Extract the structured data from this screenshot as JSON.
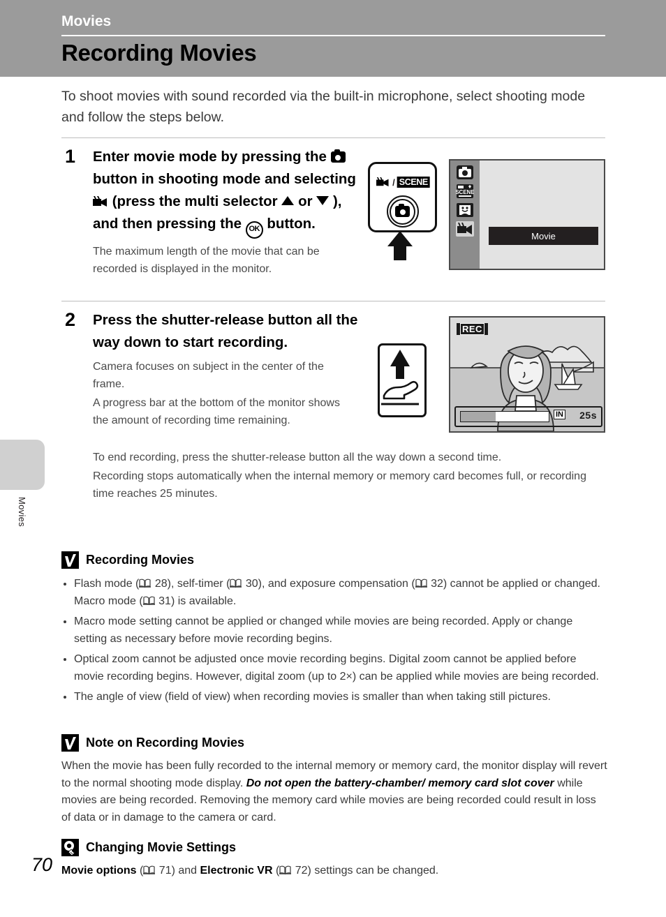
{
  "header": {
    "chapter": "Movies",
    "title": "Recording Movies"
  },
  "thumb_tab": {
    "label": "Movies"
  },
  "intro": "To shoot movies with sound recorded via the built-in microphone, select shooting mode and follow the steps below.",
  "steps": [
    {
      "number": "1",
      "head_part1": "Enter movie mode by pressing the",
      "head_part2": "button in shooting mode and selecting",
      "head_part3": "(press the multi selector",
      "head_part4": "or",
      "head_part5": "), and then pressing the",
      "head_part6": "button.",
      "sub": [
        "The maximum length of the movie that can be recorded is displayed in the monitor."
      ]
    },
    {
      "number": "2",
      "head": "Press the shutter-release button all the way down to start recording.",
      "sub": [
        "Camera focuses on subject in the center of the frame.",
        "A progress bar at the bottom of the monitor shows the amount of recording time remaining."
      ],
      "wide": [
        "To end recording, press the shutter-release button all the way down a second time.",
        "Recording stops automatically when the internal memory or memory card becomes full, or recording time reaches 25 minutes."
      ]
    }
  ],
  "figures": {
    "button_card": {
      "movie_scene_label": "SCENE",
      "separator": "/"
    },
    "monitor_step1": {
      "mode_icons": [
        "auto-camera-mode-icon",
        "scene-mode-icon",
        "smart-portrait-mode-icon",
        "movie-mode-icon"
      ],
      "selected_mode": "movie-mode-icon",
      "menu_item": "Movie"
    },
    "monitor_step2": {
      "rec_badge": "REC",
      "memory_badge": "IN",
      "time_remaining": "25s",
      "progress_percent": 40
    }
  },
  "notes": [
    {
      "icon": "caution-check-icon",
      "title": "Recording Movies",
      "bullets": [
        {
          "segments": [
            {
              "t": "Flash mode ("
            },
            {
              "t": "book-icon",
              "type": "icon"
            },
            {
              "t": " 28), self-timer ("
            },
            {
              "t": "book-icon",
              "type": "icon"
            },
            {
              "t": " 30), and exposure compensation ("
            },
            {
              "t": "book-icon",
              "type": "icon"
            },
            {
              "t": " 32) cannot be applied or changed. Macro mode ("
            },
            {
              "t": "book-icon",
              "type": "icon"
            },
            {
              "t": " 31) is available."
            }
          ]
        },
        {
          "segments": [
            {
              "t": "Macro mode setting cannot be applied or changed while movies are being recorded. Apply or change setting as necessary before movie recording begins."
            }
          ]
        },
        {
          "segments": [
            {
              "t": "Optical zoom cannot be adjusted once movie recording begins. Digital zoom cannot be applied before movie recording begins. However, digital zoom (up to 2×) can be applied while movies are being recorded."
            }
          ]
        },
        {
          "segments": [
            {
              "t": "The angle of view (field of view) when recording movies is smaller than when taking still pictures."
            }
          ]
        }
      ]
    },
    {
      "icon": "caution-check-icon",
      "title": "Note on Recording Movies",
      "paragraph_1": "When the movie has been fully recorded to the internal memory or memory card, the monitor display will revert to the normal shooting mode display. ",
      "paragraph_bold_1": "Do not open the battery-chamber/ memory card slot cover",
      "paragraph_2": " while movies are being recorded. Removing the memory card while movies are being recorded could result in loss of data or in damage to the camera or card."
    },
    {
      "icon": "tip-bulb-icon",
      "title": "Changing Movie Settings",
      "tip_bold_1": "Movie options",
      "tip_ref_1": " 71) and ",
      "tip_bold_2": "Electronic VR",
      "tip_ref_2": " 72) settings can be changed."
    }
  ],
  "folio": "70",
  "colors": {
    "header_band": "#9b9b9b",
    "thumb_tab": "#d0d0d0",
    "body_text": "#3a3a3a",
    "monitor_bg": "#e3e3e3",
    "mode_column": "#8c8c8c"
  }
}
